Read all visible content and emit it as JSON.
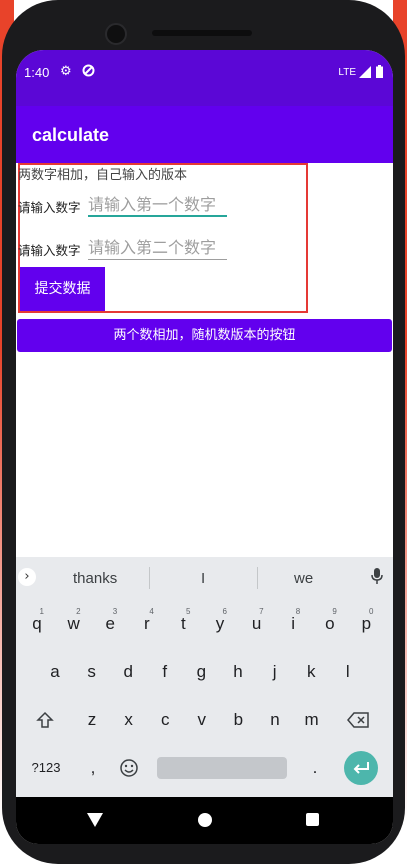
{
  "status_bar": {
    "time": "1:40",
    "network": "LTE",
    "icons": [
      "gear-icon",
      "data-saver-icon",
      "signal-icon",
      "battery-icon"
    ]
  },
  "app_bar": {
    "title": "calculate"
  },
  "form": {
    "intro": "两数字相加，自己输入的版本",
    "label_first": "请输入数字",
    "placeholder_first": "请输入第一个数字",
    "label_second": "请输入数字",
    "placeholder_second": "请输入第二个数字",
    "submit_label": "提交数据"
  },
  "random_button_label": "两个数相加，随机数版本的按钮",
  "keyboard": {
    "suggestions": [
      "thanks",
      "I",
      "we"
    ],
    "row1": [
      {
        "k": "q",
        "n": "1"
      },
      {
        "k": "w",
        "n": "2"
      },
      {
        "k": "e",
        "n": "3"
      },
      {
        "k": "r",
        "n": "4"
      },
      {
        "k": "t",
        "n": "5"
      },
      {
        "k": "y",
        "n": "6"
      },
      {
        "k": "u",
        "n": "7"
      },
      {
        "k": "i",
        "n": "8"
      },
      {
        "k": "o",
        "n": "9"
      },
      {
        "k": "p",
        "n": "0"
      }
    ],
    "row2": [
      "a",
      "s",
      "d",
      "f",
      "g",
      "h",
      "j",
      "k",
      "l"
    ],
    "row3": [
      "z",
      "x",
      "c",
      "v",
      "b",
      "n",
      "m"
    ],
    "symbols_label": "?123",
    "comma": ",",
    "period": "."
  },
  "colors": {
    "primary": "#6200ee",
    "status_bar": "#5b07d6",
    "accent": "#26a69a",
    "highlight_border": "#e53935"
  }
}
